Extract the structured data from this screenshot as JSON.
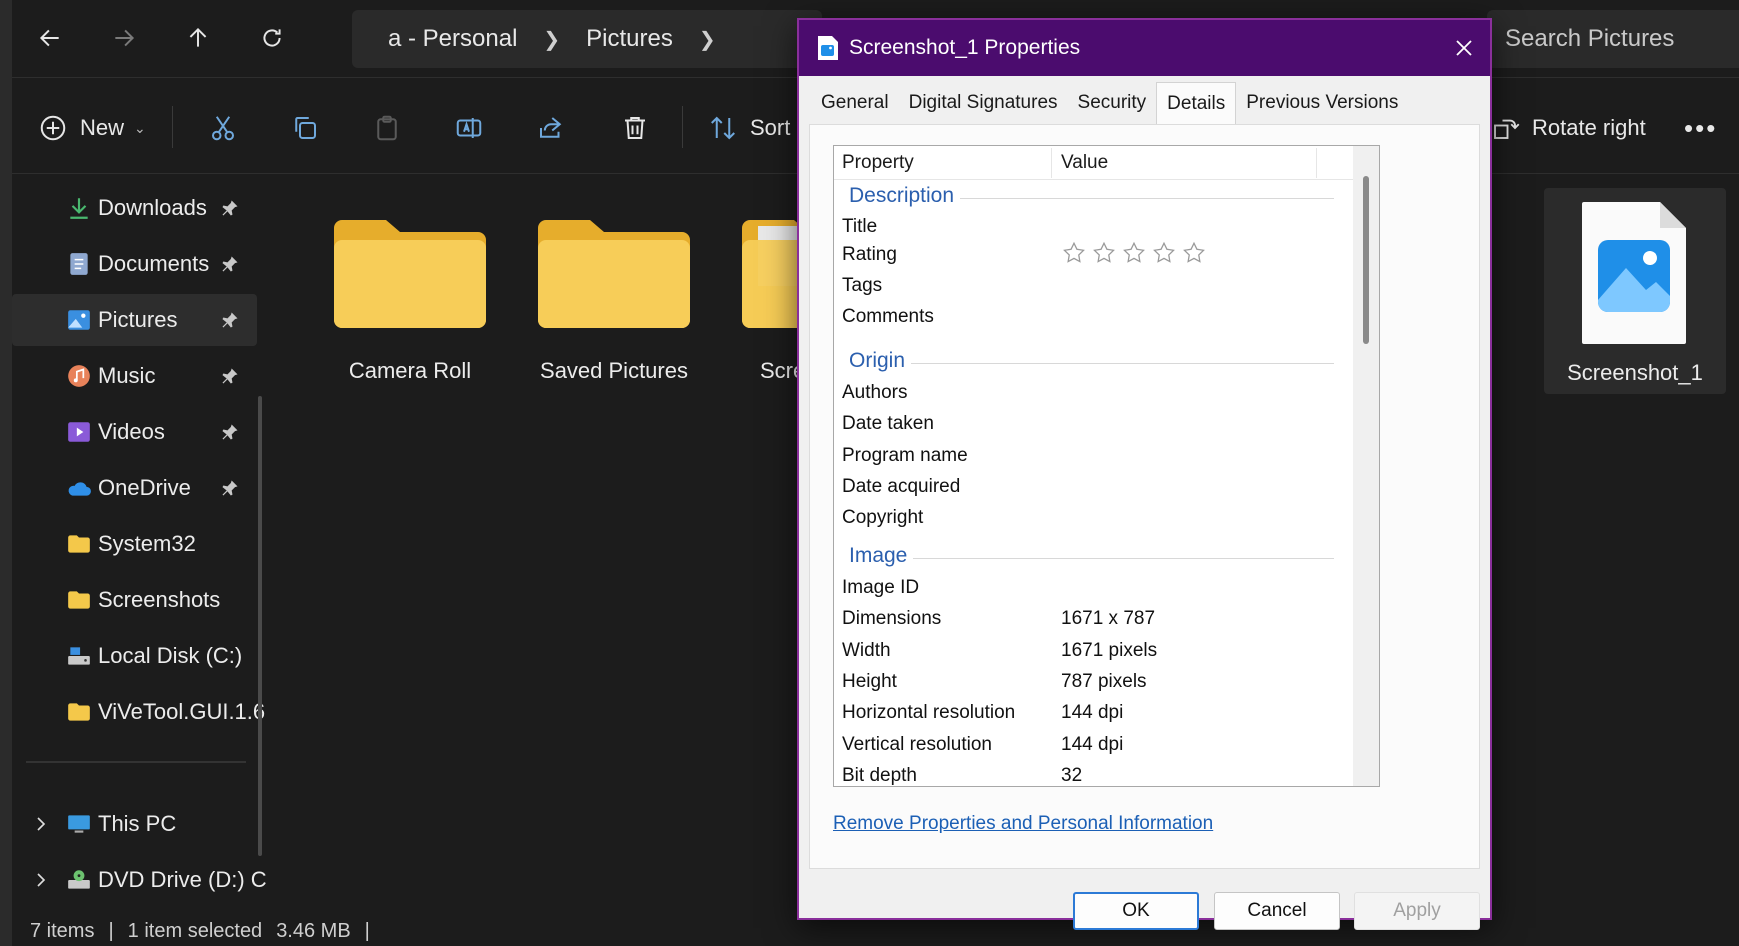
{
  "explorer": {
    "breadcrumb": [
      "a - Personal",
      "Pictures"
    ],
    "search_placeholder": "Search Pictures",
    "toolbar": {
      "new_label": "New",
      "sort_label": "Sort",
      "rotate_right_label": "Rotate right"
    },
    "nav": [
      {
        "label": "Downloads",
        "icon": "download-icon",
        "pinned": true
      },
      {
        "label": "Documents",
        "icon": "document-icon",
        "pinned": true
      },
      {
        "label": "Pictures",
        "icon": "pictures-icon",
        "pinned": true,
        "selected": true
      },
      {
        "label": "Music",
        "icon": "music-icon",
        "pinned": true
      },
      {
        "label": "Videos",
        "icon": "videos-icon",
        "pinned": true
      },
      {
        "label": "OneDrive",
        "icon": "onedrive-icon",
        "pinned": true
      },
      {
        "label": "System32",
        "icon": "folder-icon"
      },
      {
        "label": "Screenshots",
        "icon": "folder-icon"
      },
      {
        "label": "Local Disk (C:)",
        "icon": "drive-icon"
      },
      {
        "label": "ViVeTool.GUI.1.6",
        "icon": "folder-icon"
      },
      {
        "label": "This PC",
        "icon": "pc-icon",
        "expandable": true
      },
      {
        "label": "DVD Drive (D:) C",
        "icon": "dvd-icon",
        "expandable": true
      }
    ],
    "folders": [
      {
        "label": "Camera Roll"
      },
      {
        "label": "Saved Pictures"
      },
      {
        "label": "Scre"
      }
    ],
    "selected_file": {
      "label": "Screenshot_1"
    },
    "status": {
      "item_count": "7 items",
      "selection": "1 item selected",
      "size": "3.46 MB"
    }
  },
  "dialog": {
    "title": "Screenshot_1 Properties",
    "tabs": [
      "General",
      "Digital Signatures",
      "Security",
      "Details",
      "Previous Versions"
    ],
    "active_tab": "Details",
    "columns": {
      "property": "Property",
      "value": "Value"
    },
    "sections": {
      "description": {
        "heading": "Description",
        "rows": [
          {
            "k": "Title",
            "v": ""
          },
          {
            "k": "Rating",
            "v": ""
          },
          {
            "k": "Tags",
            "v": ""
          },
          {
            "k": "Comments",
            "v": ""
          }
        ]
      },
      "origin": {
        "heading": "Origin",
        "rows": [
          {
            "k": "Authors",
            "v": ""
          },
          {
            "k": "Date taken",
            "v": ""
          },
          {
            "k": "Program name",
            "v": ""
          },
          {
            "k": "Date acquired",
            "v": ""
          },
          {
            "k": "Copyright",
            "v": ""
          }
        ]
      },
      "image": {
        "heading": "Image",
        "rows": [
          {
            "k": "Image ID",
            "v": ""
          },
          {
            "k": "Dimensions",
            "v": "1671 x 787"
          },
          {
            "k": "Width",
            "v": "1671 pixels"
          },
          {
            "k": "Height",
            "v": "787 pixels"
          },
          {
            "k": "Horizontal resolution",
            "v": "144 dpi"
          },
          {
            "k": "Vertical resolution",
            "v": "144 dpi"
          },
          {
            "k": "Bit depth",
            "v": "32"
          }
        ]
      }
    },
    "rating_stars": 0,
    "remove_link": "Remove Properties and Personal Information",
    "buttons": {
      "ok": "OK",
      "cancel": "Cancel",
      "apply": "Apply"
    }
  },
  "colors": {
    "title_bar": "#4b0c6e",
    "dialog_border": "#8a2f9b",
    "section_heading": "#2b5fae",
    "link": "#1b5fb5",
    "folder_yellow": "#f4c84a"
  }
}
